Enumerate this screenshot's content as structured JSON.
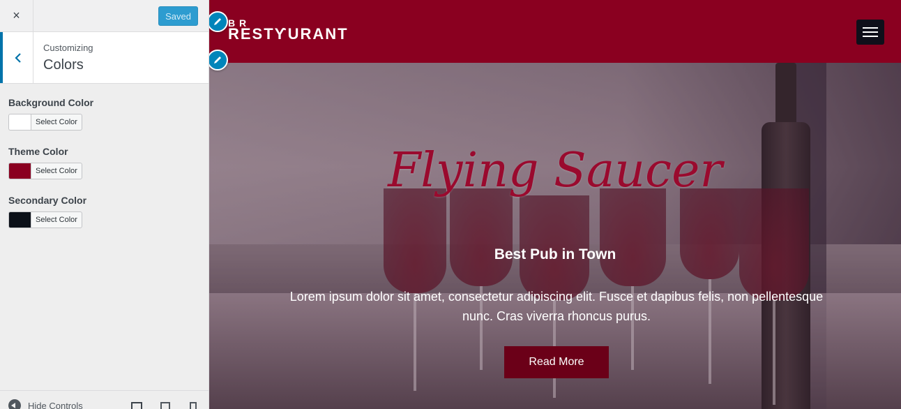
{
  "sidebar": {
    "close_icon": "×",
    "saved_label": "Saved",
    "customizing_label": "Customizing",
    "section_title": "Colors",
    "controls": [
      {
        "label": "Background Color",
        "button": "Select Color",
        "color": "#ffffff"
      },
      {
        "label": "Theme Color",
        "button": "Select Color",
        "color": "#8a0020"
      },
      {
        "label": "Secondary Color",
        "button": "Select Color",
        "color": "#0b1018"
      }
    ],
    "footer": {
      "hide_controls": "Hide Controls"
    }
  },
  "preview": {
    "logo_top": "B R",
    "logo_main": "RESTϒURANT",
    "hero_title": "Flying Saucer",
    "hero_subtitle": "Best Pub in Town",
    "hero_text": "Lorem ipsum dolor sit amet, consectetur adipiscing elit. Fusce et dapibus felis, non pellentesque nunc. Cras viverra rhoncus purus.",
    "read_more": "Read More"
  },
  "colors": {
    "header_bg": "#8a0020",
    "accent_blue": "#0085ba",
    "saved_button": "#2d9cd0",
    "cta_bg": "#6b0018"
  }
}
